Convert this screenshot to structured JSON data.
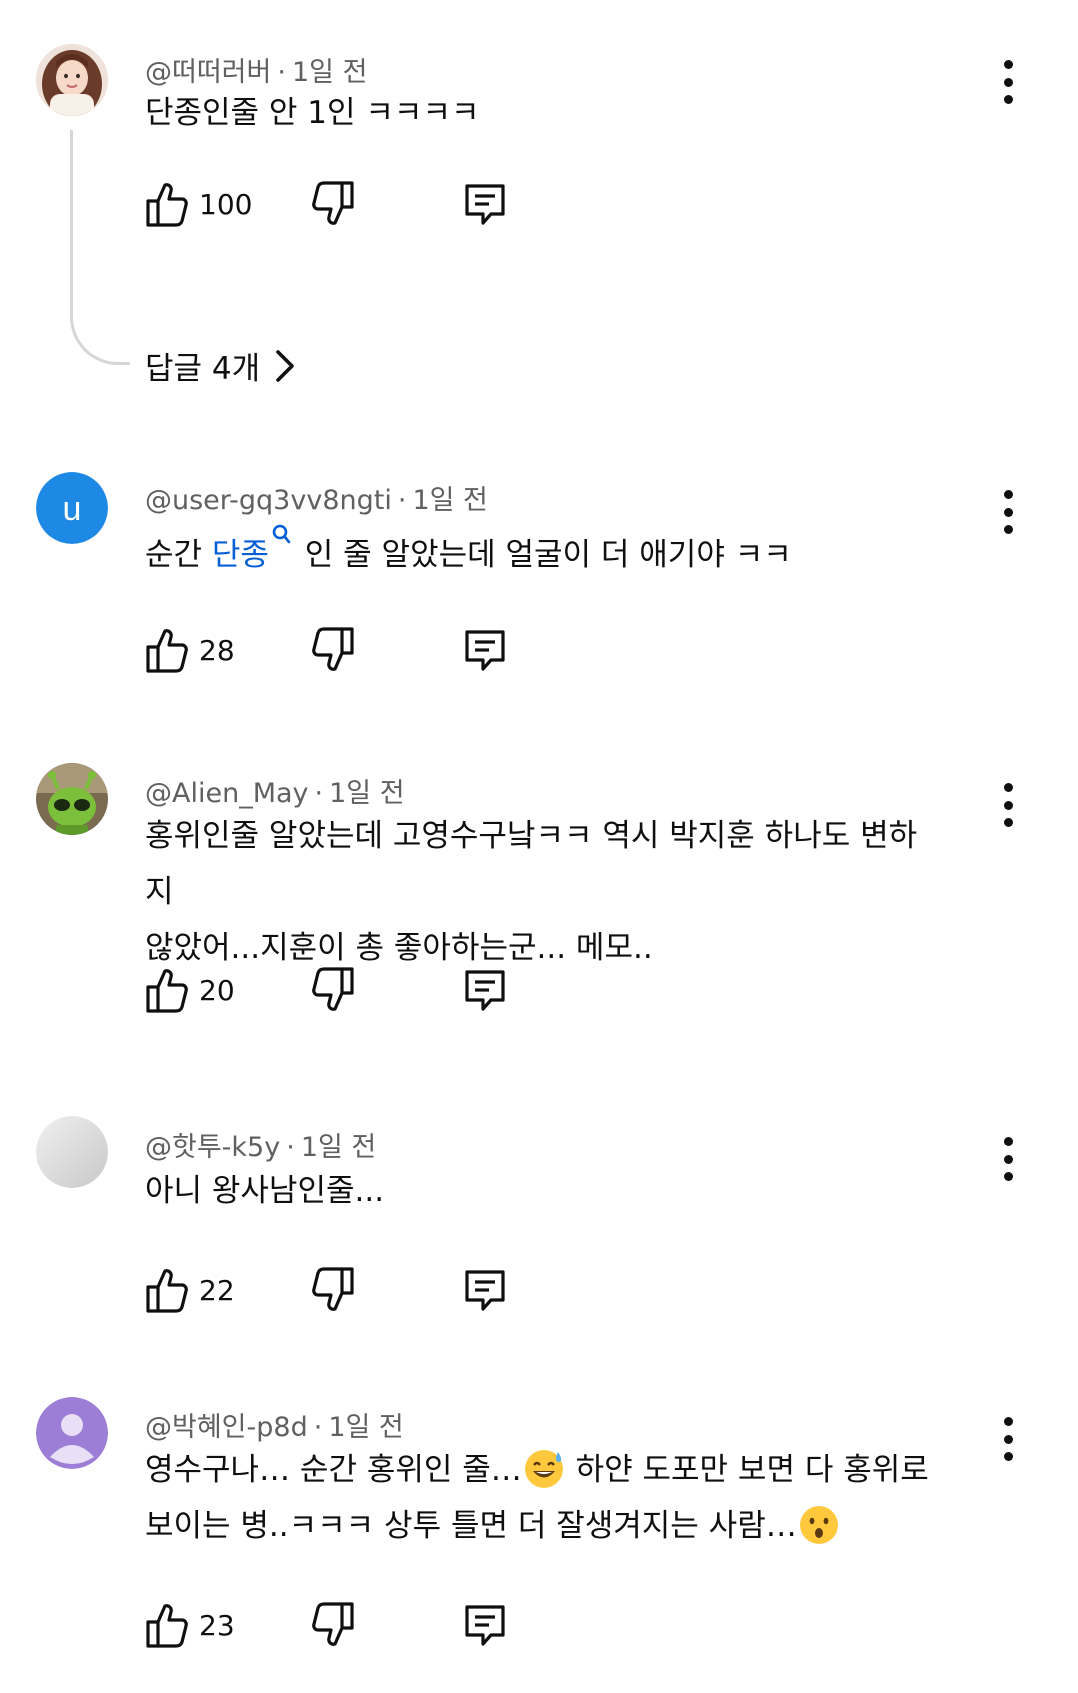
{
  "comments": [
    {
      "author": "@떠떠러버",
      "time": "1일 전",
      "text": "단종인줄 안 1인 ㅋㅋㅋㅋ",
      "likes": "100",
      "avatar": "photo-girl",
      "replies_label": "답글 4개"
    },
    {
      "author": "@user-gq3vv8ngti",
      "time": "1일 전",
      "text_before": "순간 ",
      "text_link": "단종",
      "text_after": " 인 줄 알았는데 얼굴이 더 애기야 ㅋㅋ",
      "likes": "28",
      "avatar": "letter-u",
      "avatar_letter": "u",
      "avatar_color": "#1e88e5"
    },
    {
      "author": "@Alien_May",
      "time": "1일 전",
      "text_line1": "홍위인줄 알았는데 고영수구낰ㅋㅋ 역시 박지훈 하나도 변하지",
      "text_line2": "않았어...지훈이 총 좋아하는군... 메모..",
      "likes": "20",
      "avatar": "alien-plush"
    },
    {
      "author": "@핫투-k5y",
      "time": "1일 전",
      "text": "아니 왕사남인줄...",
      "likes": "22",
      "avatar": "grey-circle"
    },
    {
      "author": "@박혜인-p8d",
      "time": "1일 전",
      "text_line1_a": "영수구나… 순간 홍위인 줄…",
      "text_line1_b": " 하얀 도포만 보면 다 홍위로",
      "text_line2_a": "보이는 병..ㅋㅋㅋ 상투 틀면 더 잘생겨지는 사람…",
      "likes": "23",
      "avatar": "default-person",
      "avatar_color": "#9c7ed6"
    }
  ],
  "icons": {
    "like": "thumbs-up-icon",
    "dislike": "thumbs-down-icon",
    "reply": "comment-icon",
    "menu": "more-vert-icon",
    "chevron": "chevron-right-icon",
    "search": "search-icon",
    "emoji1": "sweat-smile-emoji",
    "emoji2": "astonished-face-emoji"
  }
}
